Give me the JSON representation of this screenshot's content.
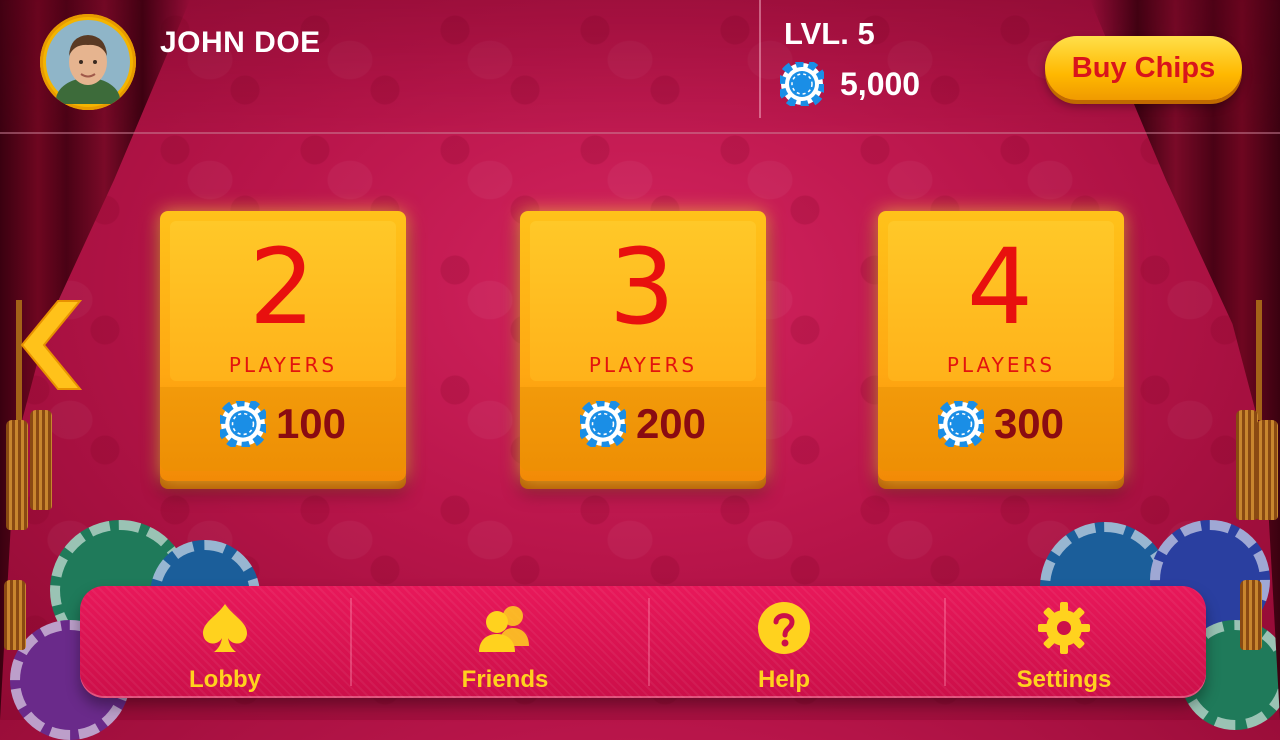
{
  "player": {
    "name": "JOHN DOE",
    "level": "LVL. 5",
    "chips": "5,000"
  },
  "header": {
    "buy_chips_label": "Buy Chips"
  },
  "tables": [
    {
      "number": "2",
      "players_label": "PLAYERS",
      "cost": "100"
    },
    {
      "number": "3",
      "players_label": "PLAYERS",
      "cost": "200"
    },
    {
      "number": "4",
      "players_label": "PLAYERS",
      "cost": "300"
    }
  ],
  "nav": {
    "items": [
      {
        "label": "Lobby",
        "icon": "spade-icon"
      },
      {
        "label": "Friends",
        "icon": "friends-icon"
      },
      {
        "label": "Help",
        "icon": "help-icon"
      },
      {
        "label": "Settings",
        "icon": "gear-icon"
      }
    ]
  },
  "colors": {
    "accent_gold": "#ffd21e",
    "card_number_red": "#e8100e",
    "background_red": "#b8154a"
  }
}
